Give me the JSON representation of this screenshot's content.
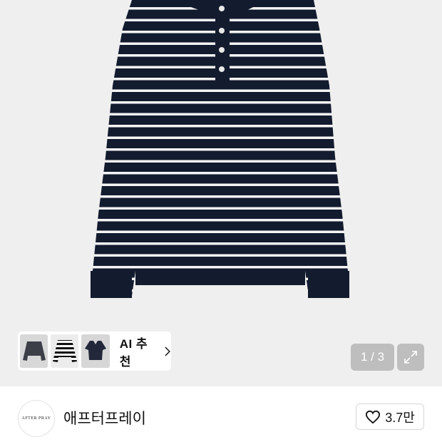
{
  "product_image": {
    "alt_icon": "striped-henley-sweater-image"
  },
  "ai_recommend": {
    "label": "AI 추천",
    "thumbnails": [
      "grey-sweater-thumb",
      "striped-sweater-thumb",
      "navy-polo-thumb"
    ]
  },
  "gallery": {
    "counter": "1 / 3"
  },
  "brand": {
    "logo_text": "AFTER PRAY",
    "name": "애프터프레이"
  },
  "like": {
    "count": "3.7만"
  },
  "colors": {
    "navy": "#131b2e",
    "stripe": "#ffffff",
    "hero_bg": "#efefef"
  }
}
